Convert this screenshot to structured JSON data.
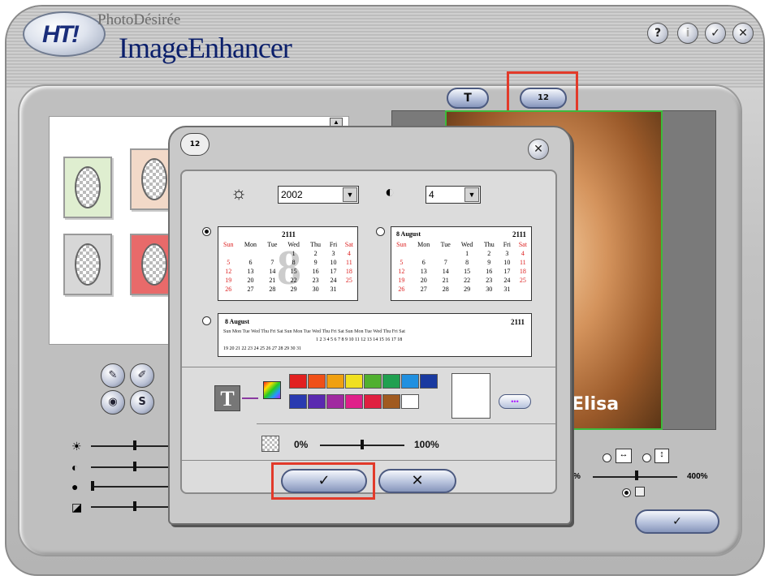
{
  "app": {
    "brand_small": "PhotoDésirée",
    "brand_big": "ImageEnhancer",
    "logo": "HT!"
  },
  "titlebar": {
    "help": "?",
    "info": "i",
    "ok": "✓",
    "close": "✕"
  },
  "left": {
    "tool_icons": [
      "pen-icon",
      "pencil-icon",
      "blur-icon",
      "s-icon"
    ],
    "sliders": [
      {
        "name": "brightness",
        "value": 0.5
      },
      {
        "name": "contrast",
        "value": 0.5
      },
      {
        "name": "saturation",
        "value": 0.02
      },
      {
        "name": "edge",
        "value": 0.5
      }
    ]
  },
  "preview": {
    "text_button": "T",
    "calendar_button": "12",
    "photo_name": "Elisa"
  },
  "zoom": {
    "min_label": "%",
    "max_label": "400%",
    "ok": "✓"
  },
  "dialog": {
    "icon": "12",
    "close": "✕",
    "year": "2002",
    "month": "4",
    "cal1": {
      "year": "2111",
      "days_head": [
        "Sun",
        "Mon",
        "Tue",
        "Wed",
        "Thu",
        "Fri",
        "Sat"
      ],
      "rows": [
        [
          "",
          "",
          "",
          "1",
          "2",
          "3",
          "4"
        ],
        [
          "5",
          "6",
          "7",
          "8",
          "9",
          "10",
          "11"
        ],
        [
          "12",
          "13",
          "14",
          "15",
          "16",
          "17",
          "18"
        ],
        [
          "19",
          "20",
          "21",
          "22",
          "23",
          "24",
          "25"
        ],
        [
          "26",
          "27",
          "28",
          "29",
          "30",
          "31",
          ""
        ]
      ],
      "big": "8"
    },
    "cal2": {
      "month": "8  August",
      "year": "2111",
      "days_head": [
        "Sun",
        "Mon",
        "Tue",
        "Wed",
        "Thu",
        "Fri",
        "Sat"
      ],
      "rows": [
        [
          "",
          "",
          "",
          "1",
          "2",
          "3",
          "4"
        ],
        [
          "5",
          "6",
          "7",
          "8",
          "9",
          "10",
          "11"
        ],
        [
          "12",
          "13",
          "14",
          "15",
          "16",
          "17",
          "18"
        ],
        [
          "19",
          "20",
          "21",
          "22",
          "23",
          "24",
          "25"
        ],
        [
          "26",
          "27",
          "28",
          "29",
          "30",
          "31",
          ""
        ]
      ]
    },
    "cal3": {
      "month": "8  August",
      "year": "2111",
      "head": "Sun Mon Tue Wed Thu Fri Sat Sun Mon Tue Wed Thu Fri Sat Sun Mon Tue Wed Thu Fri Sat",
      "row1": "1 2 3 4 5 6 7 8 9 10 11 12 13 14 15 16 17 18",
      "row2": "19 20 21 22 23 24 25 26 27 28 29 30 31"
    },
    "text_tool": "T",
    "colors": [
      "#e22020",
      "#f05018",
      "#f0a010",
      "#f0e020",
      "#50b030",
      "#20a050",
      "#2090e0",
      "#1a3aa0",
      "#2a3ab0",
      "#5a2ab0",
      "#a02aa0",
      "#e0208a",
      "#e02040",
      "#a05a20",
      "#ffffff"
    ],
    "opacity_min": "0%",
    "opacity_max": "100%",
    "opacity_value": 0.5,
    "ok": "✓",
    "cancel": "✕"
  },
  "colors_theme": {
    "accent": "#1a2d7a",
    "highlight": "#e23a2a",
    "photo_border": "#3cba3c"
  }
}
